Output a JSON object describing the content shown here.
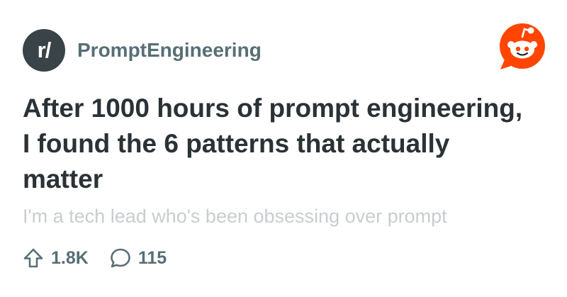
{
  "subreddit": {
    "avatar_text": "r/",
    "name": "PromptEngineering"
  },
  "post": {
    "title": "After 1000 hours of prompt engineering, I found the 6 patterns that actually matter",
    "snippet": "I'm a tech lead who's been obsessing over prompt"
  },
  "stats": {
    "upvotes": "1.8K",
    "comments": "115"
  },
  "icons": {
    "upvote": "upvote-arrow-icon",
    "comment": "comment-bubble-icon",
    "logo": "reddit-snoo-logo"
  },
  "colors": {
    "brand": "#ff4500",
    "title": "#2a3236",
    "muted": "#576f76",
    "snippet": "#c8cdcf",
    "avatar_bg": "#3a4448"
  }
}
